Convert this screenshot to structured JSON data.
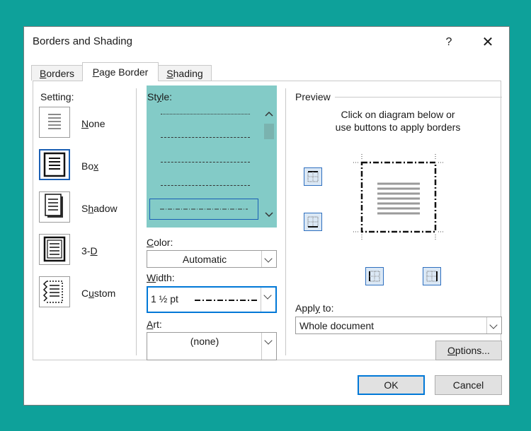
{
  "dialog": {
    "title": "Borders and Shading",
    "help_label": "?",
    "close_label": "✕"
  },
  "tabs": [
    {
      "prefix": "",
      "key": "B",
      "rest": "orders"
    },
    {
      "prefix": "",
      "key": "P",
      "rest": "age Border"
    },
    {
      "prefix": "",
      "key": "S",
      "rest": "hading"
    }
  ],
  "setting": {
    "heading": "Setting:",
    "items": [
      {
        "key": "N",
        "rest": "one"
      },
      {
        "key": "",
        "pre": "Bo",
        "keymid": "x",
        "rest": ""
      },
      {
        "pre": "S",
        "keymid": "h",
        "rest": "adow"
      },
      {
        "pre": "3-",
        "keymid": "D",
        "rest": ""
      },
      {
        "pre": "C",
        "keymid": "u",
        "rest": "stom"
      }
    ]
  },
  "style": {
    "heading_key": "y",
    "heading_pre": "St",
    "heading_rest": "le:"
  },
  "color": {
    "label_pre": "",
    "label_key": "C",
    "label_rest": "olor:",
    "value": "Automatic"
  },
  "width": {
    "label_pre": "",
    "label_key": "W",
    "label_rest": "idth:",
    "value": "1 ½ pt"
  },
  "art": {
    "label_pre": "",
    "label_key": "A",
    "label_rest": "rt:",
    "value": "(none)"
  },
  "preview": {
    "heading": "Preview",
    "instruction_line1": "Click on diagram below or",
    "instruction_line2": "use buttons to apply borders"
  },
  "apply_to": {
    "label_pre": "Appl",
    "label_key": "y",
    "label_rest": " to:",
    "value": "Whole document"
  },
  "buttons": {
    "options_key": "O",
    "options_rest": "ptions...",
    "ok": "OK",
    "cancel": "Cancel"
  },
  "colors": {
    "backdrop": "#0ea19a",
    "style_list_highlight": "#83cbc7",
    "accent": "#0078d7"
  }
}
